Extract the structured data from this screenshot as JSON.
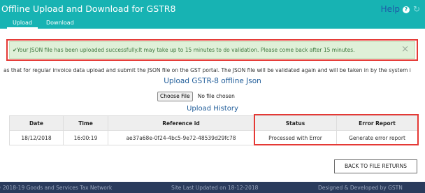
{
  "header": {
    "title": "Offline Upload and Download for GSTR8",
    "help_label": "Help",
    "tabs": [
      {
        "label": "Upload",
        "active": true
      },
      {
        "label": "Download",
        "active": false
      }
    ],
    "background_color": "#17b3b3"
  },
  "alert": {
    "message": "Your JSON file has been uploaded successfully.It may take up to 15 minutes to do validation. Please come back after 15 minutes.",
    "close_symbol": "×",
    "icon": "check-circle-icon"
  },
  "info_text": "as that for regular invoice data upload and submit the JSON file on the GST portal. The JSON file will be validated again and will be taken in by the system i",
  "upload": {
    "heading": "Upload GSTR-8 offline Json",
    "choose_file_label": "Choose File",
    "no_file_label": "No file chosen"
  },
  "history": {
    "heading": "Upload History",
    "columns": [
      "Date",
      "Time",
      "Reference id",
      "Status",
      "Error Report"
    ],
    "rows": [
      {
        "date": "18/12/2018",
        "time": "16:00:19",
        "reference_id": "ae37a68e-0f24-4bc5-9e72-48539d29fc78",
        "status": "Processed with Error",
        "error_report": "Generate error report"
      }
    ]
  },
  "back_button": "BACK TO FILE RETURNS",
  "footer": {
    "copyright": "© 2018-19 Goods and Services Tax Network",
    "updated": "Site Last Updated on 18-12-2018",
    "credit": "Designed & Developed by GSTN"
  }
}
